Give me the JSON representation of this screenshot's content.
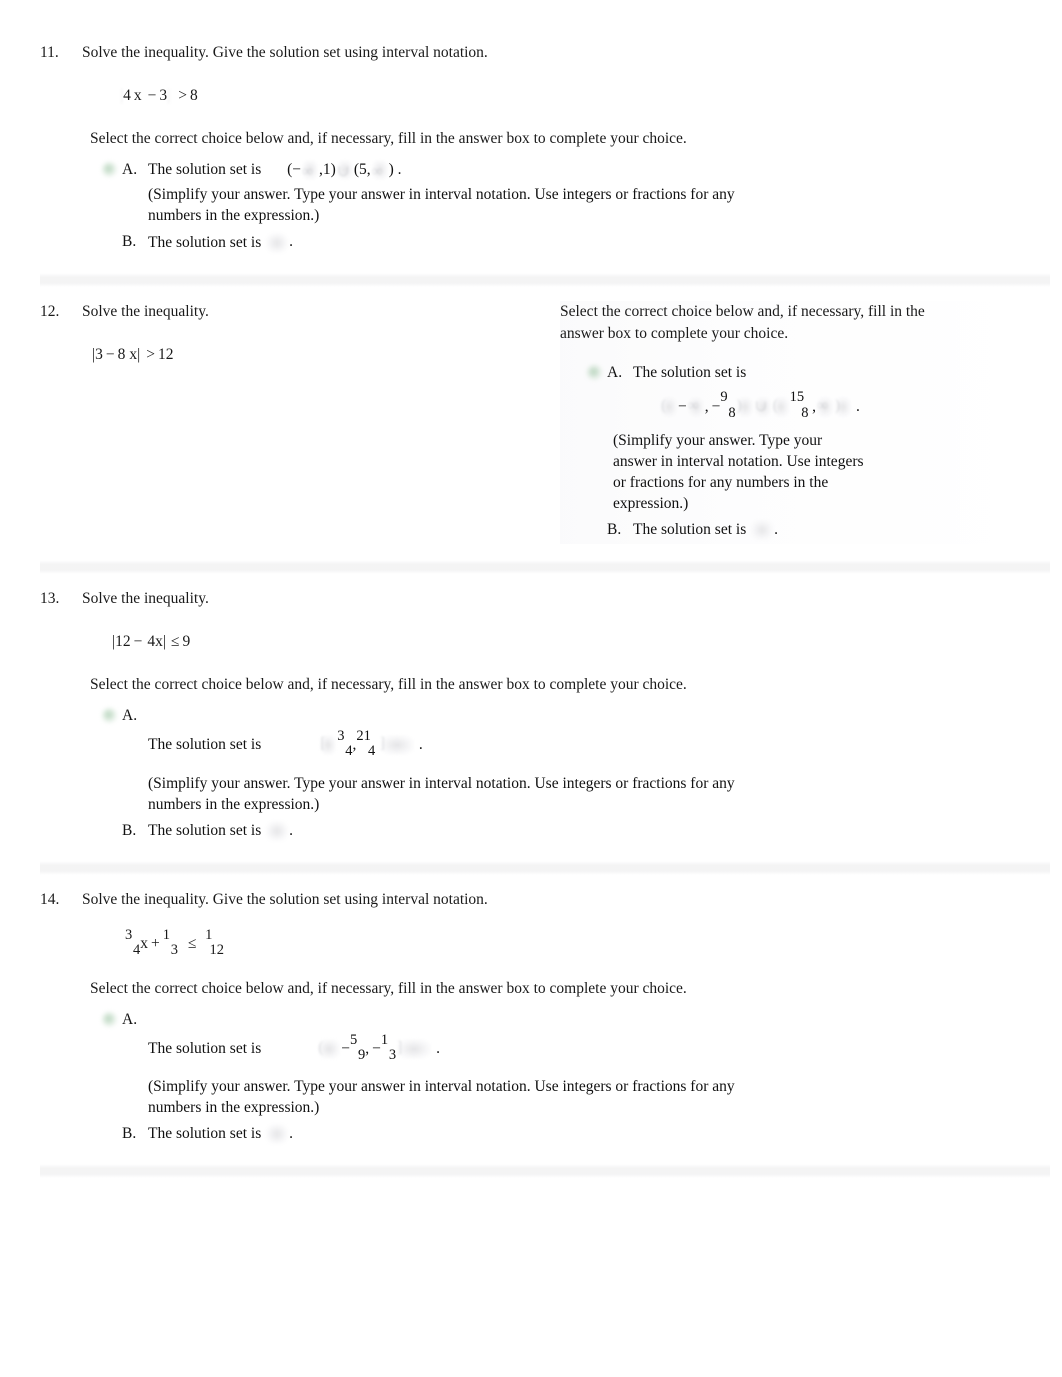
{
  "document": {
    "type": "math-worksheet",
    "accent_color": "#7aaf82",
    "text_color": "#111111"
  },
  "common": {
    "select_choice_instruction": "Select the correct choice below and, if necessary, fill in the answer box to complete your choice.",
    "select_choice_instruction_wrapped_line1": "Select the correct choice below and, if necessary, fill in the",
    "select_choice_instruction_wrapped_line2": "answer box to complete your choice.",
    "hint_line1": "(Simplify your answer. Type your answer in interval notation. Use integers or fractions for any",
    "hint_line2": "numbers in the expression.)",
    "hint_narrow_line1": "(Simplify your answer. Type your",
    "hint_narrow_line2": "answer in interval notation. Use integers",
    "hint_narrow_line3": "or fractions for any numbers in the",
    "hint_narrow_line4": "expression.)",
    "solution_set_label": "The solution set is",
    "letter_a": "A.",
    "letter_b": "B.",
    "period": ".",
    "comma": ",",
    "minus": "−",
    "infinity": "∞",
    "union": "∪",
    "lparen": "(",
    "rparen": ")",
    "lbracket": "[",
    "rbracket": "]"
  },
  "problems": [
    {
      "number": "11.",
      "stem": "Solve the inequality. Give the solution set using interval notation.",
      "expression": {
        "lead": "4",
        "var": "x",
        "minus": "−",
        "const": "3",
        "relation": ">",
        "rhs": "8"
      },
      "choice_a": {
        "label": "A.",
        "text": "The solution set is",
        "answer_parts": {
          "open1": "(",
          "neg": "−",
          "inf1": "∞",
          "comma1": ",",
          "one": "1",
          "close1": ")",
          "union": "∪",
          "open2": "(",
          "five": "5,",
          "inf2": "∞",
          "close2": ")",
          "period": "."
        }
      },
      "choice_b": {
        "label": "B.",
        "text": "The solution set is",
        "period": "."
      }
    },
    {
      "number": "12.",
      "stem": "Solve the inequality.",
      "expression": {
        "bar_left": "|",
        "lead": "3",
        "minus": "−",
        "coef": "8",
        "var": "x",
        "bar_right": "|",
        "relation": ">",
        "rhs": "12"
      },
      "choice_a": {
        "label": "A.",
        "text": "The solution set is",
        "answer_parts": {
          "open1": "(",
          "neg_inf_sign": "−",
          "inf1": "∞",
          "comma1": ",",
          "neg2": "−",
          "frac1_num": "9",
          "frac1_den": "8",
          "close1": ")",
          "union": "∪",
          "open2": "(",
          "frac2_num": "15",
          "frac2_den": "8",
          "comma2": ",",
          "inf2": "∞",
          "close2": ")",
          "period": "."
        }
      },
      "choice_b": {
        "label": "B.",
        "text": "The solution set is",
        "period": "."
      }
    },
    {
      "number": "13.",
      "stem": "Solve the inequality.",
      "expression": {
        "bar_left": "|",
        "lead": "12",
        "minus": "−",
        "coef": "4x",
        "bar_right": "|",
        "relation": "≤",
        "rhs": "9"
      },
      "choice_a": {
        "label": "A.",
        "text": "The solution set is",
        "answer_parts": {
          "open": "[",
          "frac1_num": "3",
          "frac1_den": "4",
          "comma": ",",
          "frac2_num": "21",
          "frac2_den": "4",
          "close": "]",
          "period": "."
        }
      },
      "choice_b": {
        "label": "B.",
        "text": "The solution set is",
        "period": "."
      }
    },
    {
      "number": "14.",
      "stem": "Solve the inequality. Give the solution set using interval notation.",
      "expression": {
        "frac1_num": "3",
        "frac1_den": "4",
        "var": "x",
        "plus": "+",
        "frac2_num": "1",
        "frac2_den": "3",
        "relation": "≤",
        "frac3_num": "1",
        "frac3_den": "12"
      },
      "choice_a": {
        "label": "A.",
        "text": "The solution set is",
        "answer_parts": {
          "open": "(",
          "neg_inf_sign": "−",
          "inf": "∞",
          "comma1": ",",
          "neg1": "−",
          "frac1_num": "5",
          "frac1_den": "9",
          "comma2": ",",
          "neg2": "−",
          "frac2_num": "1",
          "frac2_den": "3",
          "close": "]",
          "period": "."
        }
      },
      "choice_b": {
        "label": "B.",
        "text": "The solution set is",
        "period": "."
      }
    }
  ]
}
